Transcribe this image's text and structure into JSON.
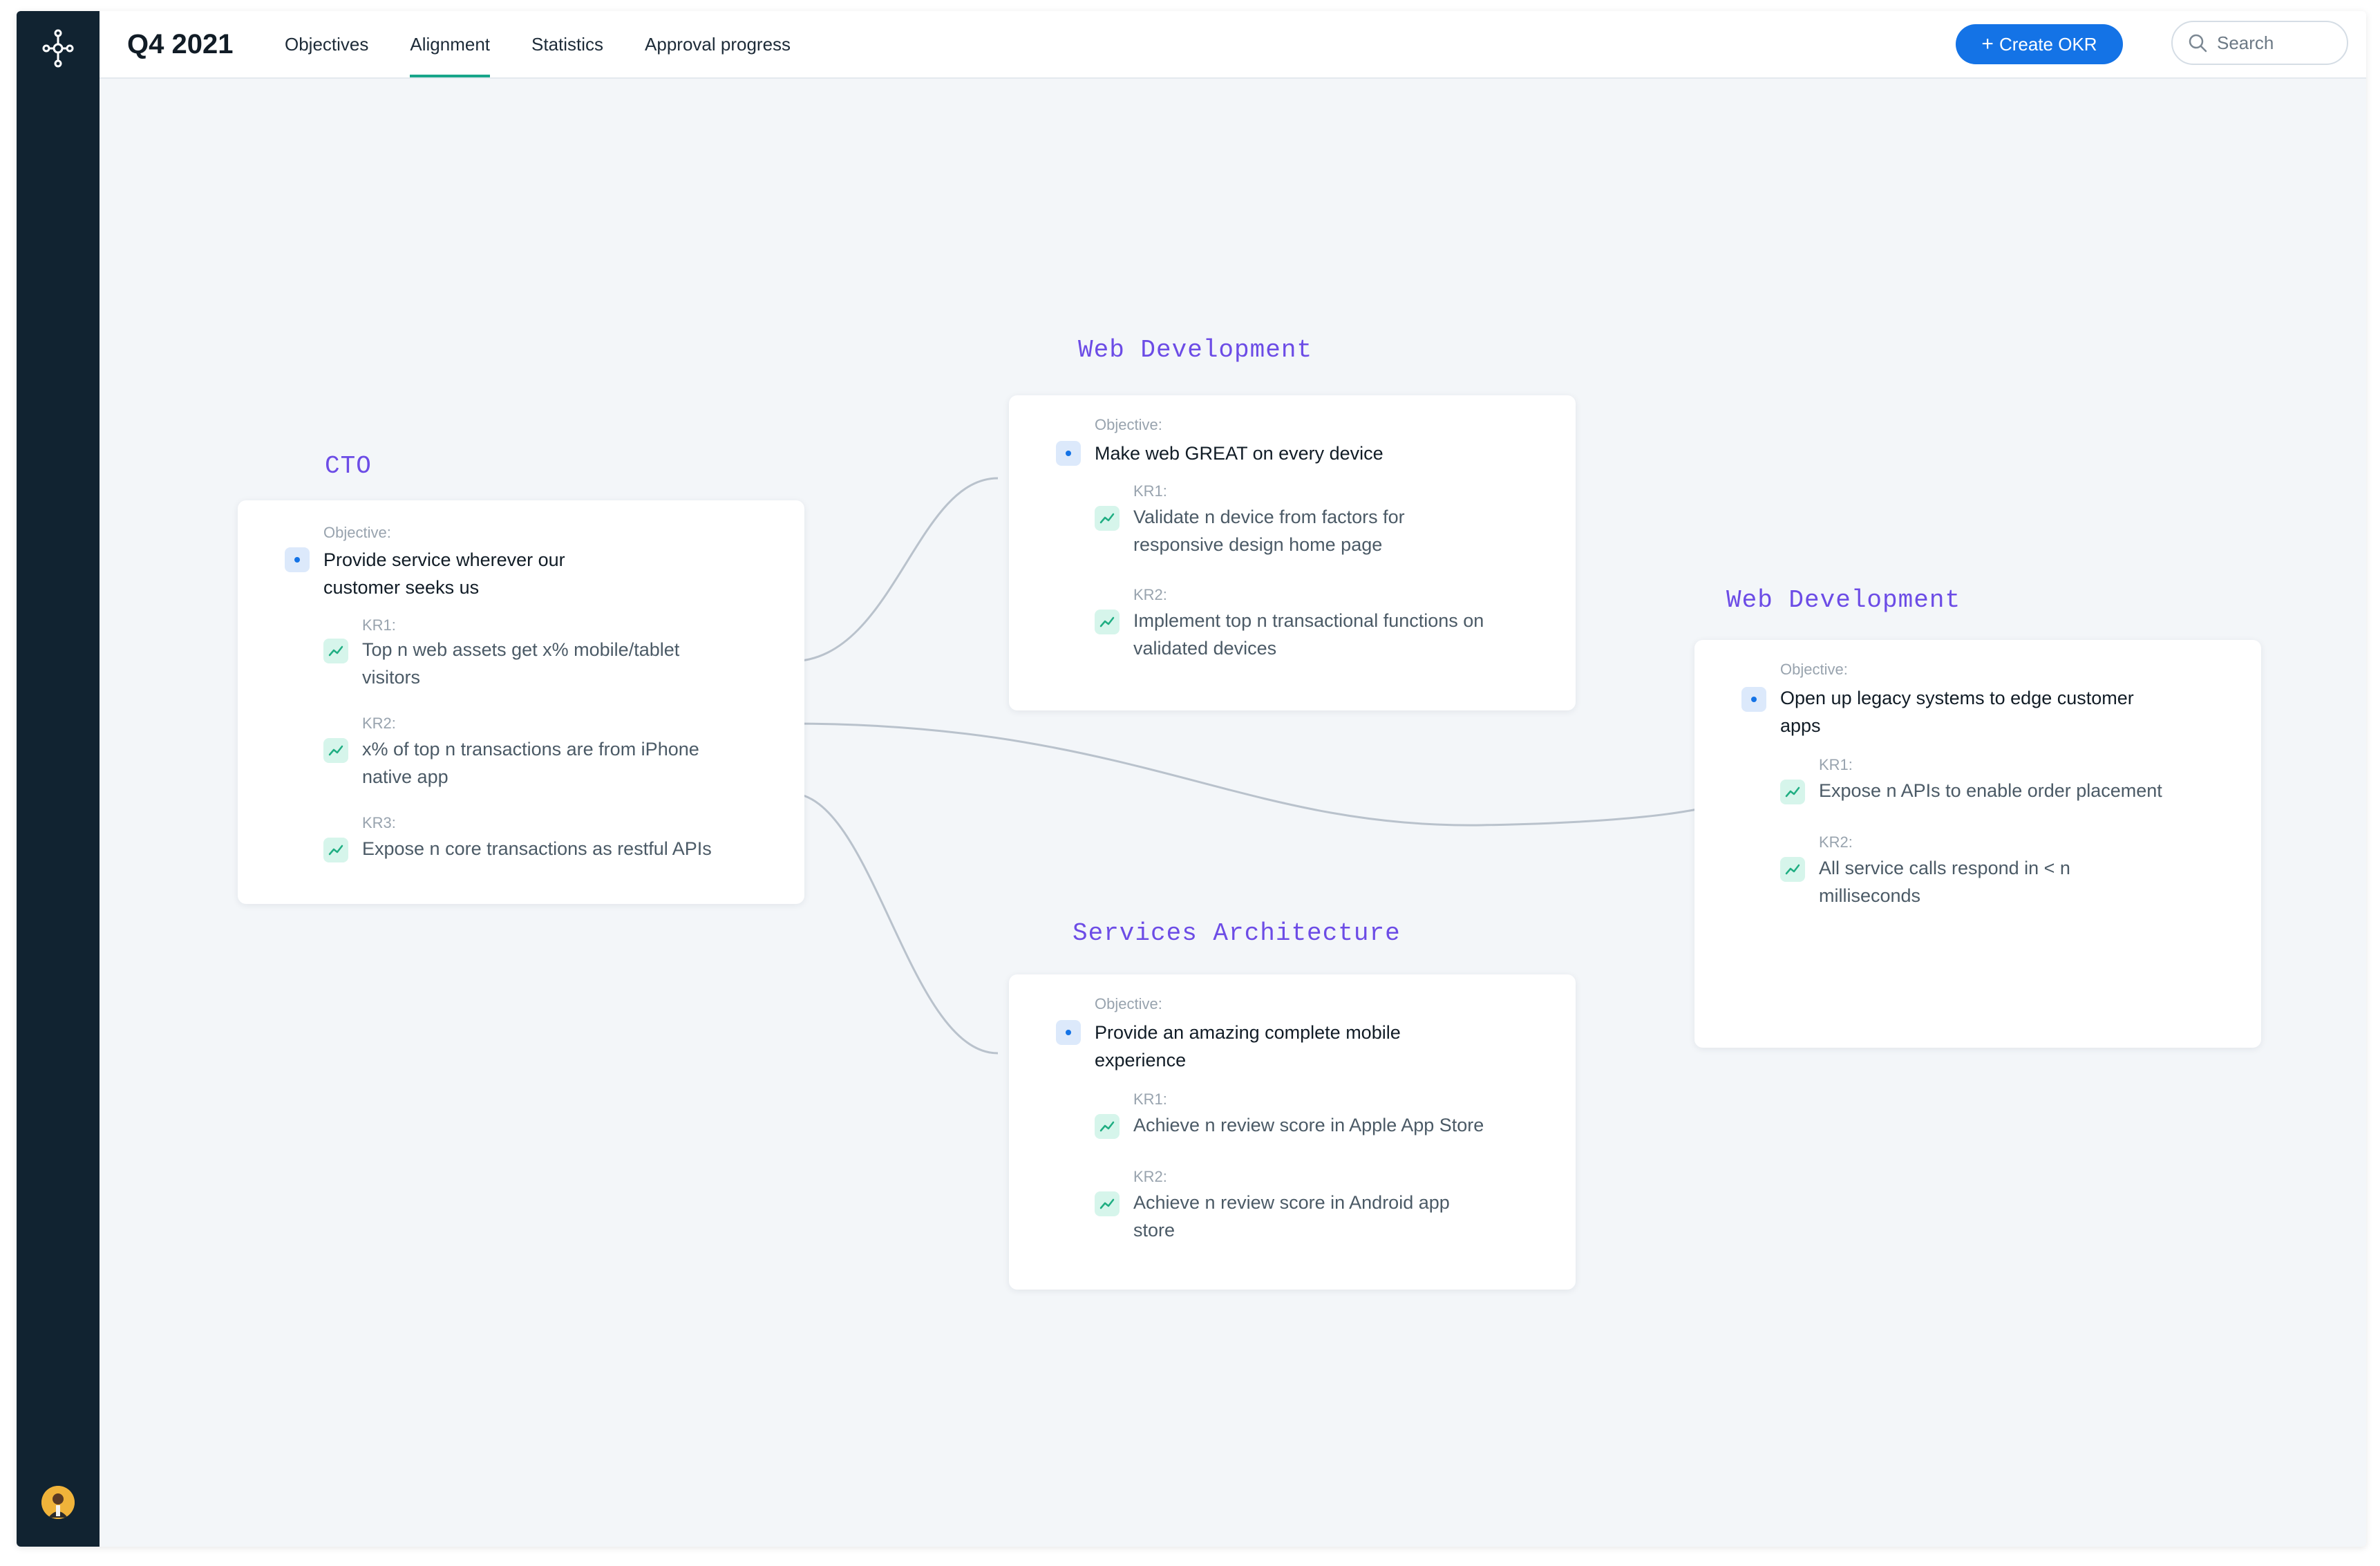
{
  "header": {
    "title": "Q4 2021",
    "tabs": [
      {
        "label": "Objectives"
      },
      {
        "label": "Alignment"
      },
      {
        "label": "Statistics"
      },
      {
        "label": "Approval progress"
      }
    ],
    "active_tab": "Alignment",
    "create_button_label": "Create OKR",
    "search_placeholder": "Search"
  },
  "colors": {
    "sidebar": "#112331",
    "accent_blue": "#1473e6",
    "active_tab_underline": "#18a58a",
    "team_label": "#6c4ce6",
    "connector": "#b9c2cc"
  },
  "icons": {
    "logo": "network-nodes-icon",
    "create": "plus-icon",
    "search": "search-icon",
    "objective": "objective-dot-icon",
    "key_result": "trend-up-icon"
  },
  "cards": [
    {
      "team": "CTO",
      "objective_caption": "Objective:",
      "objective_lines": [
        "Provide service wherever our",
        "customer seeks us"
      ],
      "key_results": [
        {
          "label": "KR1:",
          "lines": [
            "Top n web assets get x% mobile/tablet",
            "visitors"
          ]
        },
        {
          "label": "KR2:",
          "lines": [
            "x% of top n transactions are from iPhone",
            "native app"
          ]
        },
        {
          "label": "KR3:",
          "lines": [
            "Expose n core transactions as restful APIs"
          ]
        }
      ]
    },
    {
      "team": "Web Development",
      "objective_caption": "Objective:",
      "objective_lines": [
        "Make web GREAT on every device"
      ],
      "key_results": [
        {
          "label": "KR1:",
          "lines": [
            "Validate n device from factors for",
            "responsive design home page"
          ]
        },
        {
          "label": "KR2:",
          "lines": [
            "Implement top n transactional functions on",
            "validated devices"
          ]
        }
      ]
    },
    {
      "team": "Services Architecture",
      "objective_caption": "Objective:",
      "objective_lines": [
        "Provide an amazing complete mobile",
        "experience"
      ],
      "key_results": [
        {
          "label": "KR1:",
          "lines": [
            "Achieve n review score in Apple App Store"
          ]
        },
        {
          "label": "KR2:",
          "lines": [
            "Achieve n review score in Android app",
            "store"
          ]
        }
      ]
    },
    {
      "team": "Web Development",
      "objective_caption": "Objective:",
      "objective_lines": [
        "Open up legacy systems to edge customer",
        "apps"
      ],
      "key_results": [
        {
          "label": "KR1:",
          "lines": [
            "Expose n APIs to enable order placement"
          ]
        },
        {
          "label": "KR2:",
          "lines": [
            "All service calls respond in < n",
            "milliseconds"
          ]
        }
      ]
    }
  ]
}
